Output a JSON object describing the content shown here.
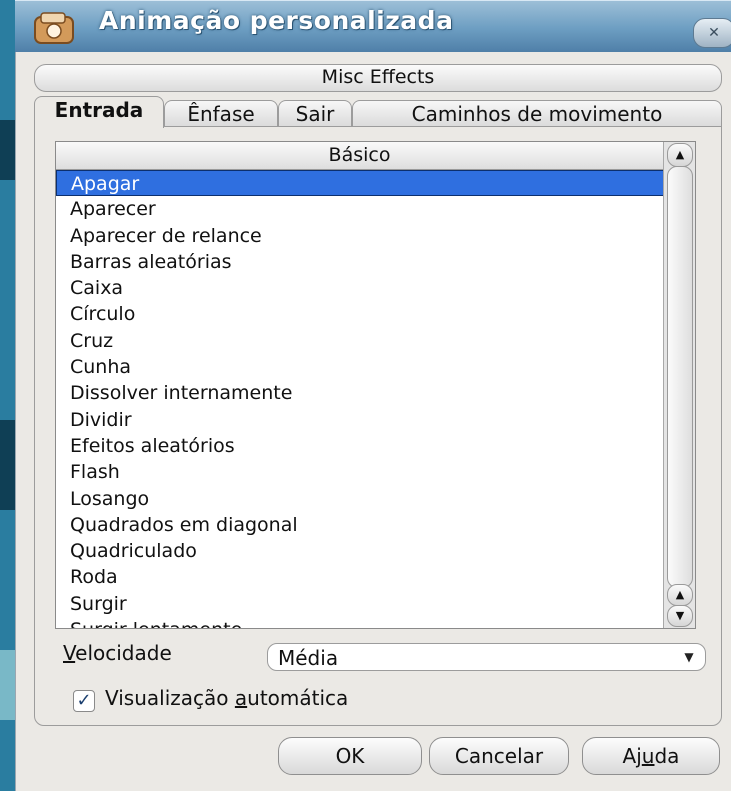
{
  "window": {
    "title": "Animação personalizada",
    "close_icon": "close-icon"
  },
  "misc_tab": {
    "label": "Misc Effects"
  },
  "tabs": [
    {
      "label": "Entrada",
      "active": true
    },
    {
      "label": "Ênfase",
      "active": false
    },
    {
      "label": "Sair",
      "active": false
    },
    {
      "label": "Caminhos de movimento",
      "active": false
    }
  ],
  "list": {
    "header": "Básico",
    "selected_index": 0,
    "items": [
      "Apagar",
      "Aparecer",
      "Aparecer de relance",
      "Barras aleatórias",
      "Caixa",
      "Círculo",
      "Cruz",
      "Cunha",
      "Dissolver internamente",
      "Dividir",
      "Efeitos aleatórios",
      "Flash",
      "Losango",
      "Quadrados em diagonal",
      "Quadriculado",
      "Roda",
      "Surgir",
      "Surgir lentamente"
    ]
  },
  "speed": {
    "label_prefix": "V",
    "label_rest": "elocidade",
    "value": "Média"
  },
  "auto_preview": {
    "checked": true,
    "label_before": "Visualização ",
    "label_mnemonic": "a",
    "label_after": "utomática"
  },
  "buttons": {
    "ok": "OK",
    "cancel": "Cancelar",
    "help_before": "Aj",
    "help_mnemonic": "u",
    "help_after": "da"
  }
}
